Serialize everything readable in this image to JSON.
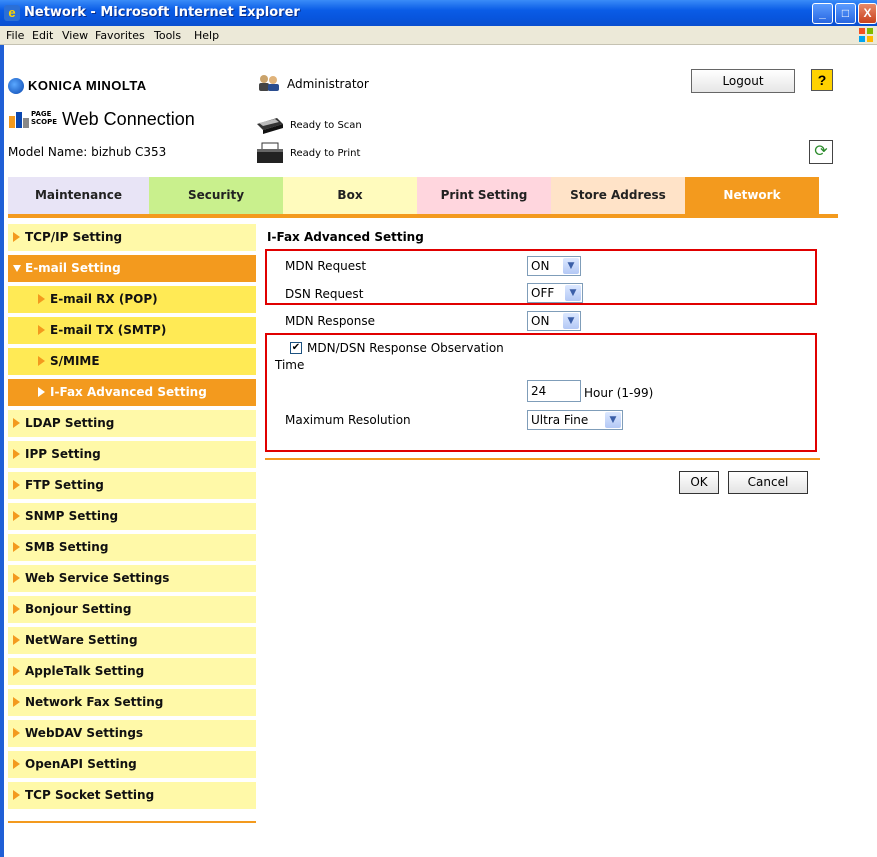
{
  "window": {
    "title": "Network - Microsoft Internet Explorer",
    "min": "_",
    "max": "□",
    "close": "X"
  },
  "menu": [
    "File",
    "Edit",
    "View",
    "Favorites",
    "Tools",
    "Help"
  ],
  "header": {
    "brand": "KONICA MINOLTA",
    "pagescope": "PAGE SCOPE",
    "web_connection": "Web Connection",
    "model": "Model Name: bizhub C353",
    "user": "Administrator",
    "scan_status": "Ready to Scan",
    "print_status": "Ready to Print",
    "logout": "Logout",
    "help": "?",
    "refresh": "⟳"
  },
  "tabs": [
    {
      "label": "Maintenance",
      "color": "#e8e4f6"
    },
    {
      "label": "Security",
      "color": "#c9f08d"
    },
    {
      "label": "Box",
      "color": "#fffbbd"
    },
    {
      "label": "Print Setting",
      "color": "#ffd6de"
    },
    {
      "label": "Store Address",
      "color": "#ffe3c8"
    },
    {
      "label": "Network",
      "color": "#f39a1e",
      "active": true
    }
  ],
  "sidebar": [
    {
      "label": "TCP/IP Setting",
      "type": "top"
    },
    {
      "label": "E-mail Setting",
      "type": "expanded"
    },
    {
      "label": "E-mail RX (POP)",
      "type": "sub"
    },
    {
      "label": "E-mail TX (SMTP)",
      "type": "sub"
    },
    {
      "label": "S/MIME",
      "type": "sub"
    },
    {
      "label": "I-Fax Advanced Setting",
      "type": "sub-active"
    },
    {
      "label": "LDAP Setting",
      "type": "top"
    },
    {
      "label": "IPP Setting",
      "type": "top"
    },
    {
      "label": "FTP Setting",
      "type": "top"
    },
    {
      "label": "SNMP Setting",
      "type": "top"
    },
    {
      "label": "SMB Setting",
      "type": "top"
    },
    {
      "label": "Web Service Settings",
      "type": "top"
    },
    {
      "label": "Bonjour Setting",
      "type": "top"
    },
    {
      "label": "NetWare Setting",
      "type": "top"
    },
    {
      "label": "AppleTalk Setting",
      "type": "top"
    },
    {
      "label": "Network Fax Setting",
      "type": "top"
    },
    {
      "label": "WebDAV Settings",
      "type": "top"
    },
    {
      "label": "OpenAPI Setting",
      "type": "top"
    },
    {
      "label": "TCP Socket Setting",
      "type": "top"
    }
  ],
  "main": {
    "title": "I-Fax Advanced Setting",
    "mdn_request_label": "MDN Request",
    "mdn_request_value": "ON",
    "dsn_request_label": "DSN Request",
    "dsn_request_value": "OFF",
    "mdn_response_label": "MDN Response",
    "mdn_response_value": "ON",
    "observation_label": "MDN/DSN Response Observation",
    "observation_checked": "✔",
    "time_label": "Time",
    "time_value": "24",
    "time_unit": "Hour (1-99)",
    "max_res_label": "Maximum Resolution",
    "max_res_value": "Ultra Fine",
    "ok": "OK",
    "cancel": "Cancel"
  }
}
